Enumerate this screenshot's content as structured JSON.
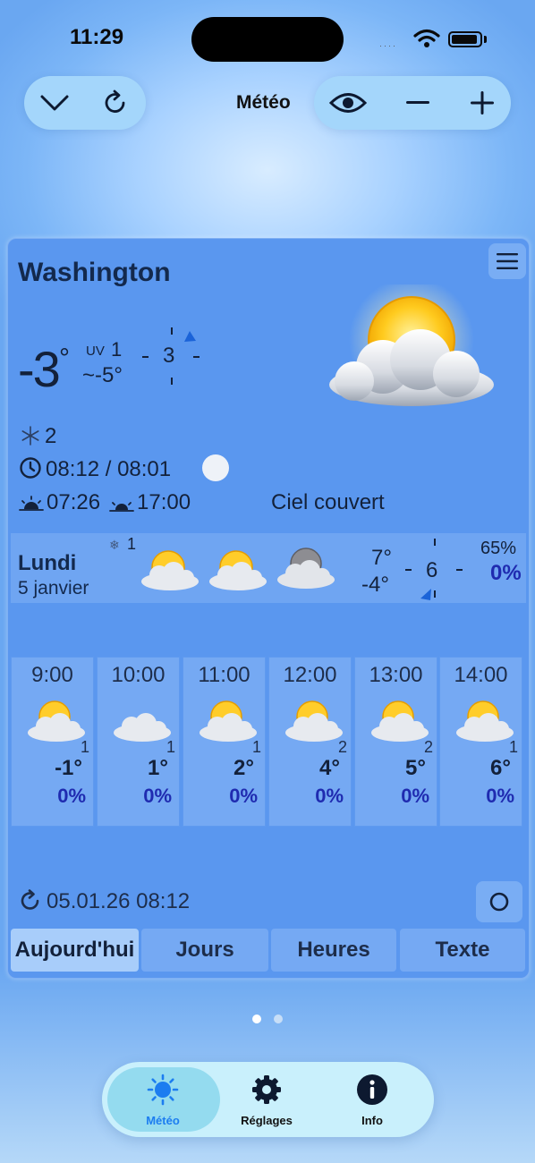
{
  "status_bar": {
    "time": "11:29",
    "signal": "····"
  },
  "nav": {
    "title": "Météo"
  },
  "current": {
    "city": "Washington",
    "temperature": "-3",
    "deg": "°",
    "uv_label": "UV",
    "uv_value": "1",
    "feels_like": "~-5°",
    "wind_speed": "3",
    "snow": "2",
    "daylight": "08:12 / 08:01",
    "sunrise": "07:26",
    "sunset": "17:00",
    "condition": "Ciel couvert"
  },
  "day": {
    "name": "Lundi",
    "date": "5 janvier",
    "snow": "1",
    "high": "7°",
    "low": "-4°",
    "wind": "6",
    "humidity": "65%",
    "precip": "0%"
  },
  "hourly": [
    {
      "time": "9:00",
      "icon": "sun-cloud-icon",
      "snow": "1",
      "temp": "-1°",
      "precip": "0%"
    },
    {
      "time": "10:00",
      "icon": "cloud-icon",
      "snow": "1",
      "temp": "1°",
      "precip": "0%"
    },
    {
      "time": "11:00",
      "icon": "sun-cloud-icon",
      "snow": "1",
      "temp": "2°",
      "precip": "0%"
    },
    {
      "time": "12:00",
      "icon": "sun-cloud-icon",
      "snow": "2",
      "temp": "4°",
      "precip": "0%"
    },
    {
      "time": "13:00",
      "icon": "sun-cloud-icon",
      "snow": "2",
      "temp": "5°",
      "precip": "0%"
    },
    {
      "time": "14:00",
      "icon": "sun-cloud-icon",
      "snow": "1",
      "temp": "6°",
      "precip": "0%"
    }
  ],
  "updated": "05.01.26 08:12",
  "tabs": [
    "Aujourd'hui",
    "Jours",
    "Heures",
    "Texte"
  ],
  "tabbar": {
    "meteo": "Météo",
    "settings": "Réglages",
    "info": "Info"
  },
  "colors": {
    "accent": "#1c7df0",
    "precip": "#1f2bb0",
    "card": "#5a97ef"
  }
}
